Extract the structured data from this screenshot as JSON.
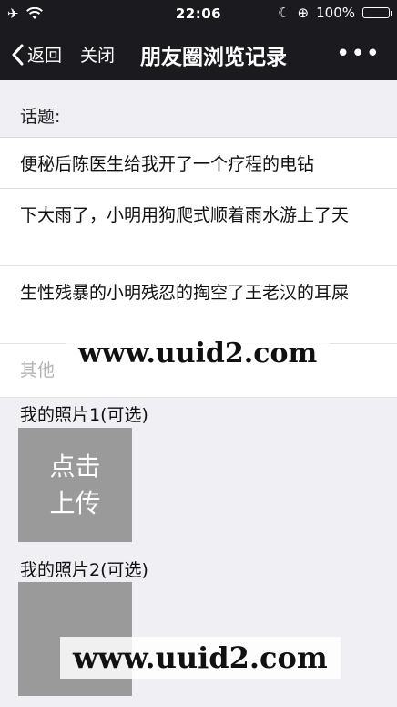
{
  "status_bar": {
    "time": "22:06",
    "battery": "100%",
    "icons": [
      "airplane-icon",
      "wifi-icon",
      "moon-icon",
      "rotation-lock-icon",
      "battery-icon"
    ]
  },
  "nav": {
    "back_label": "返回",
    "close_label": "关闭",
    "title": "朋友圈浏览记录",
    "more_label": "•••"
  },
  "topic": {
    "label": "话题:",
    "items": [
      "便秘后陈医生给我开了一个疗程的电钻",
      "下大雨了，小明用狗爬式顺着雨水游上了天",
      "生性残暴的小明残忍的掏空了王老汉的耳屎",
      "其他"
    ]
  },
  "photos": [
    {
      "label": "我的照片1(可选)",
      "upload_text": "点击上传"
    },
    {
      "label": "我的照片2(可选)",
      "upload_text": ""
    }
  ],
  "watermarks": [
    "www.uuid2.com",
    "www.uuid2.com"
  ],
  "colors": {
    "nav_bg": "#1b1b1f",
    "page_bg": "#efeff4",
    "upload_box": "#9a9a9a",
    "placeholder": "#b4b4b4"
  }
}
